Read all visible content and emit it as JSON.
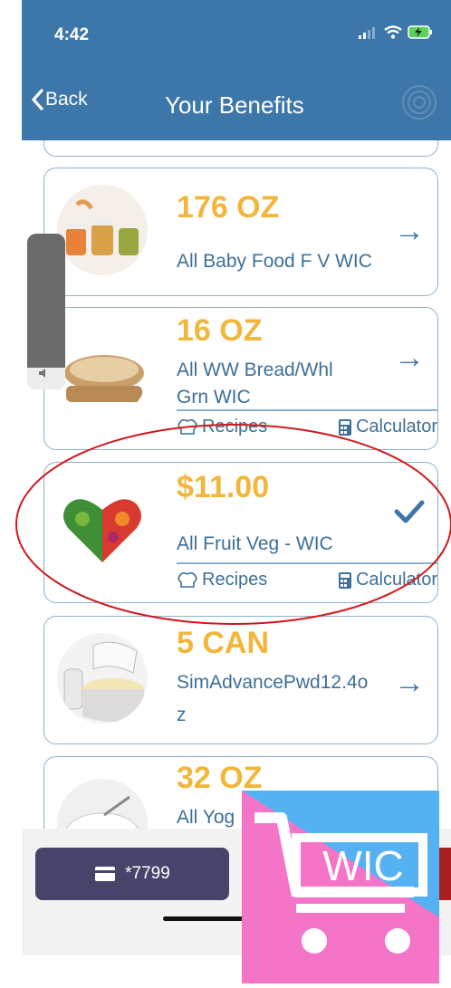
{
  "status_bar": {
    "time": "4:42"
  },
  "nav": {
    "back_label": "Back",
    "title": "Your Benefits"
  },
  "benefits": [
    {
      "quantity": "176 OZ",
      "description": "All Baby Food F V WIC",
      "action": "arrow"
    },
    {
      "quantity": "16 OZ",
      "description_line1": "All WW Bread/Whl",
      "description_line2": "Grn WIC",
      "recipes_label": "Recipes",
      "calculator_label": "Calculator",
      "action": "arrow"
    },
    {
      "quantity": "$11.00",
      "description": "All Fruit Veg - WIC",
      "recipes_label": "Recipes",
      "calculator_label": "Calculator",
      "action": "checkmark"
    },
    {
      "quantity": "5 CAN",
      "description_line1": "SimAdvancePwd12.4o",
      "description_line2": "z",
      "action": "arrow"
    },
    {
      "quantity": "32 OZ",
      "description": "All Yog",
      "action": "arrow"
    }
  ],
  "bottom_bar": {
    "card_number": "*7799"
  },
  "wic_logo": {
    "text": "WIC"
  },
  "colors": {
    "header": "#3d76a8",
    "quantity": "#f2b63a",
    "text": "#3d6f98",
    "card_button": "#46446a",
    "annotation": "#d0191c"
  }
}
